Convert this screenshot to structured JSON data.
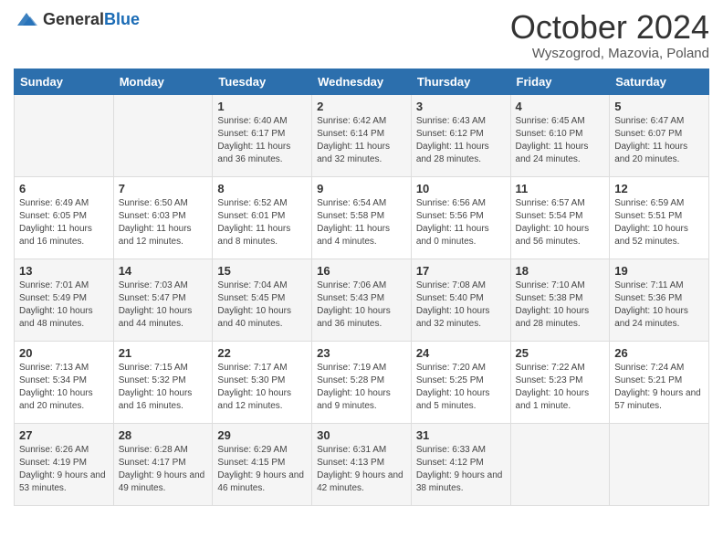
{
  "logo": {
    "text1": "General",
    "text2": "Blue"
  },
  "header": {
    "month": "October 2024",
    "location": "Wyszogrod, Mazovia, Poland"
  },
  "days_of_week": [
    "Sunday",
    "Monday",
    "Tuesday",
    "Wednesday",
    "Thursday",
    "Friday",
    "Saturday"
  ],
  "weeks": [
    [
      {
        "day": "",
        "sunrise": "",
        "sunset": "",
        "daylight": ""
      },
      {
        "day": "",
        "sunrise": "",
        "sunset": "",
        "daylight": ""
      },
      {
        "day": "1",
        "sunrise": "Sunrise: 6:40 AM",
        "sunset": "Sunset: 6:17 PM",
        "daylight": "Daylight: 11 hours and 36 minutes."
      },
      {
        "day": "2",
        "sunrise": "Sunrise: 6:42 AM",
        "sunset": "Sunset: 6:14 PM",
        "daylight": "Daylight: 11 hours and 32 minutes."
      },
      {
        "day": "3",
        "sunrise": "Sunrise: 6:43 AM",
        "sunset": "Sunset: 6:12 PM",
        "daylight": "Daylight: 11 hours and 28 minutes."
      },
      {
        "day": "4",
        "sunrise": "Sunrise: 6:45 AM",
        "sunset": "Sunset: 6:10 PM",
        "daylight": "Daylight: 11 hours and 24 minutes."
      },
      {
        "day": "5",
        "sunrise": "Sunrise: 6:47 AM",
        "sunset": "Sunset: 6:07 PM",
        "daylight": "Daylight: 11 hours and 20 minutes."
      }
    ],
    [
      {
        "day": "6",
        "sunrise": "Sunrise: 6:49 AM",
        "sunset": "Sunset: 6:05 PM",
        "daylight": "Daylight: 11 hours and 16 minutes."
      },
      {
        "day": "7",
        "sunrise": "Sunrise: 6:50 AM",
        "sunset": "Sunset: 6:03 PM",
        "daylight": "Daylight: 11 hours and 12 minutes."
      },
      {
        "day": "8",
        "sunrise": "Sunrise: 6:52 AM",
        "sunset": "Sunset: 6:01 PM",
        "daylight": "Daylight: 11 hours and 8 minutes."
      },
      {
        "day": "9",
        "sunrise": "Sunrise: 6:54 AM",
        "sunset": "Sunset: 5:58 PM",
        "daylight": "Daylight: 11 hours and 4 minutes."
      },
      {
        "day": "10",
        "sunrise": "Sunrise: 6:56 AM",
        "sunset": "Sunset: 5:56 PM",
        "daylight": "Daylight: 11 hours and 0 minutes."
      },
      {
        "day": "11",
        "sunrise": "Sunrise: 6:57 AM",
        "sunset": "Sunset: 5:54 PM",
        "daylight": "Daylight: 10 hours and 56 minutes."
      },
      {
        "day": "12",
        "sunrise": "Sunrise: 6:59 AM",
        "sunset": "Sunset: 5:51 PM",
        "daylight": "Daylight: 10 hours and 52 minutes."
      }
    ],
    [
      {
        "day": "13",
        "sunrise": "Sunrise: 7:01 AM",
        "sunset": "Sunset: 5:49 PM",
        "daylight": "Daylight: 10 hours and 48 minutes."
      },
      {
        "day": "14",
        "sunrise": "Sunrise: 7:03 AM",
        "sunset": "Sunset: 5:47 PM",
        "daylight": "Daylight: 10 hours and 44 minutes."
      },
      {
        "day": "15",
        "sunrise": "Sunrise: 7:04 AM",
        "sunset": "Sunset: 5:45 PM",
        "daylight": "Daylight: 10 hours and 40 minutes."
      },
      {
        "day": "16",
        "sunrise": "Sunrise: 7:06 AM",
        "sunset": "Sunset: 5:43 PM",
        "daylight": "Daylight: 10 hours and 36 minutes."
      },
      {
        "day": "17",
        "sunrise": "Sunrise: 7:08 AM",
        "sunset": "Sunset: 5:40 PM",
        "daylight": "Daylight: 10 hours and 32 minutes."
      },
      {
        "day": "18",
        "sunrise": "Sunrise: 7:10 AM",
        "sunset": "Sunset: 5:38 PM",
        "daylight": "Daylight: 10 hours and 28 minutes."
      },
      {
        "day": "19",
        "sunrise": "Sunrise: 7:11 AM",
        "sunset": "Sunset: 5:36 PM",
        "daylight": "Daylight: 10 hours and 24 minutes."
      }
    ],
    [
      {
        "day": "20",
        "sunrise": "Sunrise: 7:13 AM",
        "sunset": "Sunset: 5:34 PM",
        "daylight": "Daylight: 10 hours and 20 minutes."
      },
      {
        "day": "21",
        "sunrise": "Sunrise: 7:15 AM",
        "sunset": "Sunset: 5:32 PM",
        "daylight": "Daylight: 10 hours and 16 minutes."
      },
      {
        "day": "22",
        "sunrise": "Sunrise: 7:17 AM",
        "sunset": "Sunset: 5:30 PM",
        "daylight": "Daylight: 10 hours and 12 minutes."
      },
      {
        "day": "23",
        "sunrise": "Sunrise: 7:19 AM",
        "sunset": "Sunset: 5:28 PM",
        "daylight": "Daylight: 10 hours and 9 minutes."
      },
      {
        "day": "24",
        "sunrise": "Sunrise: 7:20 AM",
        "sunset": "Sunset: 5:25 PM",
        "daylight": "Daylight: 10 hours and 5 minutes."
      },
      {
        "day": "25",
        "sunrise": "Sunrise: 7:22 AM",
        "sunset": "Sunset: 5:23 PM",
        "daylight": "Daylight: 10 hours and 1 minute."
      },
      {
        "day": "26",
        "sunrise": "Sunrise: 7:24 AM",
        "sunset": "Sunset: 5:21 PM",
        "daylight": "Daylight: 9 hours and 57 minutes."
      }
    ],
    [
      {
        "day": "27",
        "sunrise": "Sunrise: 6:26 AM",
        "sunset": "Sunset: 4:19 PM",
        "daylight": "Daylight: 9 hours and 53 minutes."
      },
      {
        "day": "28",
        "sunrise": "Sunrise: 6:28 AM",
        "sunset": "Sunset: 4:17 PM",
        "daylight": "Daylight: 9 hours and 49 minutes."
      },
      {
        "day": "29",
        "sunrise": "Sunrise: 6:29 AM",
        "sunset": "Sunset: 4:15 PM",
        "daylight": "Daylight: 9 hours and 46 minutes."
      },
      {
        "day": "30",
        "sunrise": "Sunrise: 6:31 AM",
        "sunset": "Sunset: 4:13 PM",
        "daylight": "Daylight: 9 hours and 42 minutes."
      },
      {
        "day": "31",
        "sunrise": "Sunrise: 6:33 AM",
        "sunset": "Sunset: 4:12 PM",
        "daylight": "Daylight: 9 hours and 38 minutes."
      },
      {
        "day": "",
        "sunrise": "",
        "sunset": "",
        "daylight": ""
      },
      {
        "day": "",
        "sunrise": "",
        "sunset": "",
        "daylight": ""
      }
    ]
  ]
}
